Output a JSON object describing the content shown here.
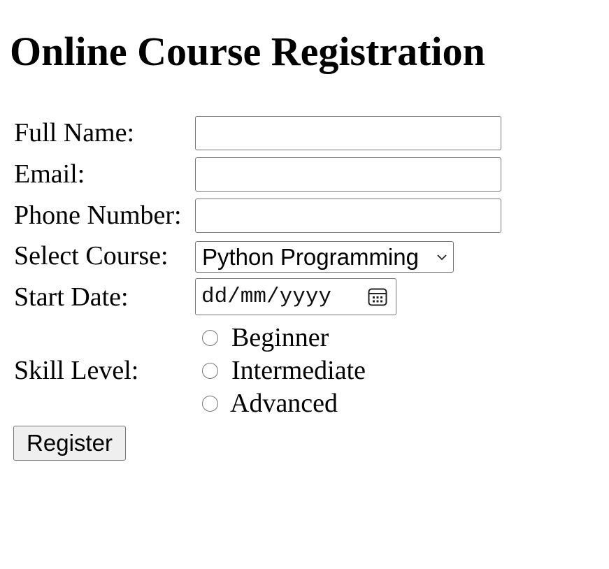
{
  "page": {
    "title": "Online Course Registration"
  },
  "form": {
    "full_name": {
      "label": "Full Name:",
      "value": ""
    },
    "email": {
      "label": "Email:",
      "value": ""
    },
    "phone": {
      "label": "Phone Number:",
      "value": ""
    },
    "course": {
      "label": "Select Course:",
      "selected": "Python Programming",
      "icon": "chevron-down-icon"
    },
    "start_date": {
      "label": "Start Date:",
      "placeholder": "dd/mm/yyyy",
      "icon": "calendar-icon"
    },
    "skill_level": {
      "label": "Skill Level:",
      "options": [
        {
          "label": "Beginner",
          "checked": false
        },
        {
          "label": "Intermediate",
          "checked": false
        },
        {
          "label": "Advanced",
          "checked": false
        }
      ]
    },
    "submit_label": "Register"
  }
}
